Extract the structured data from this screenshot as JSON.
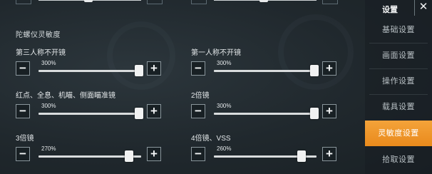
{
  "section": {
    "title": "陀螺仪灵敏度"
  },
  "settings": [
    {
      "label": "第三人称不开镜",
      "value_text": "300%",
      "value": 300
    },
    {
      "label": "第一人称不开镜",
      "value_text": "300%",
      "value": 300
    },
    {
      "label": "红点、全息、机瞄、侧面瞄准镜",
      "value_text": "300%",
      "value": 300
    },
    {
      "label": "2倍镜",
      "value_text": "300%",
      "value": 300
    },
    {
      "label": "3倍镜",
      "value_text": "270%",
      "value": 270
    },
    {
      "label": "4倍镜、VSS",
      "value_text": "260%",
      "value": 260
    }
  ],
  "buttons": {
    "minus": "−",
    "plus": "+"
  },
  "sidebar": {
    "title": "设置",
    "close": "✕",
    "items": [
      {
        "label": "基础设置",
        "active": false
      },
      {
        "label": "画面设置",
        "active": false
      },
      {
        "label": "操作设置",
        "active": false
      },
      {
        "label": "载具设置",
        "active": false
      },
      {
        "label": "灵敏度设置",
        "active": true
      },
      {
        "label": "拾取设置",
        "active": false
      }
    ]
  },
  "colors": {
    "accent": "#f09a2a",
    "background": "#222b30"
  }
}
